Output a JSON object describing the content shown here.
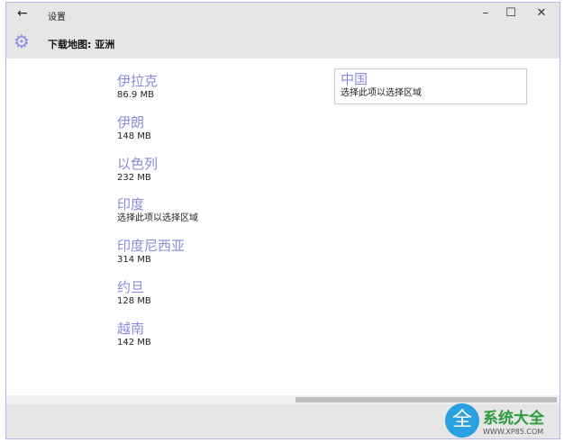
{
  "window": {
    "title": "设置",
    "back": "←",
    "minimize": "–",
    "maximize": "☐",
    "close": "✕"
  },
  "header": {
    "title": "下载地图: 亚洲",
    "icon": "gear-icon"
  },
  "countries": [
    {
      "name": "伊拉克",
      "detail": "86.9 MB"
    },
    {
      "name": "伊朗",
      "detail": "148 MB"
    },
    {
      "name": "以色列",
      "detail": "232 MB"
    },
    {
      "name": "印度",
      "detail": "选择此项以选择区域"
    },
    {
      "name": "印度尼西亚",
      "detail": "314 MB"
    },
    {
      "name": "约旦",
      "detail": "128 MB"
    },
    {
      "name": "越南",
      "detail": "142 MB"
    }
  ],
  "selected": {
    "name": "中国",
    "detail": "选择此项以选择区域"
  },
  "watermark": {
    "text": "系统大全",
    "url": "WWW.XP85.COM"
  }
}
